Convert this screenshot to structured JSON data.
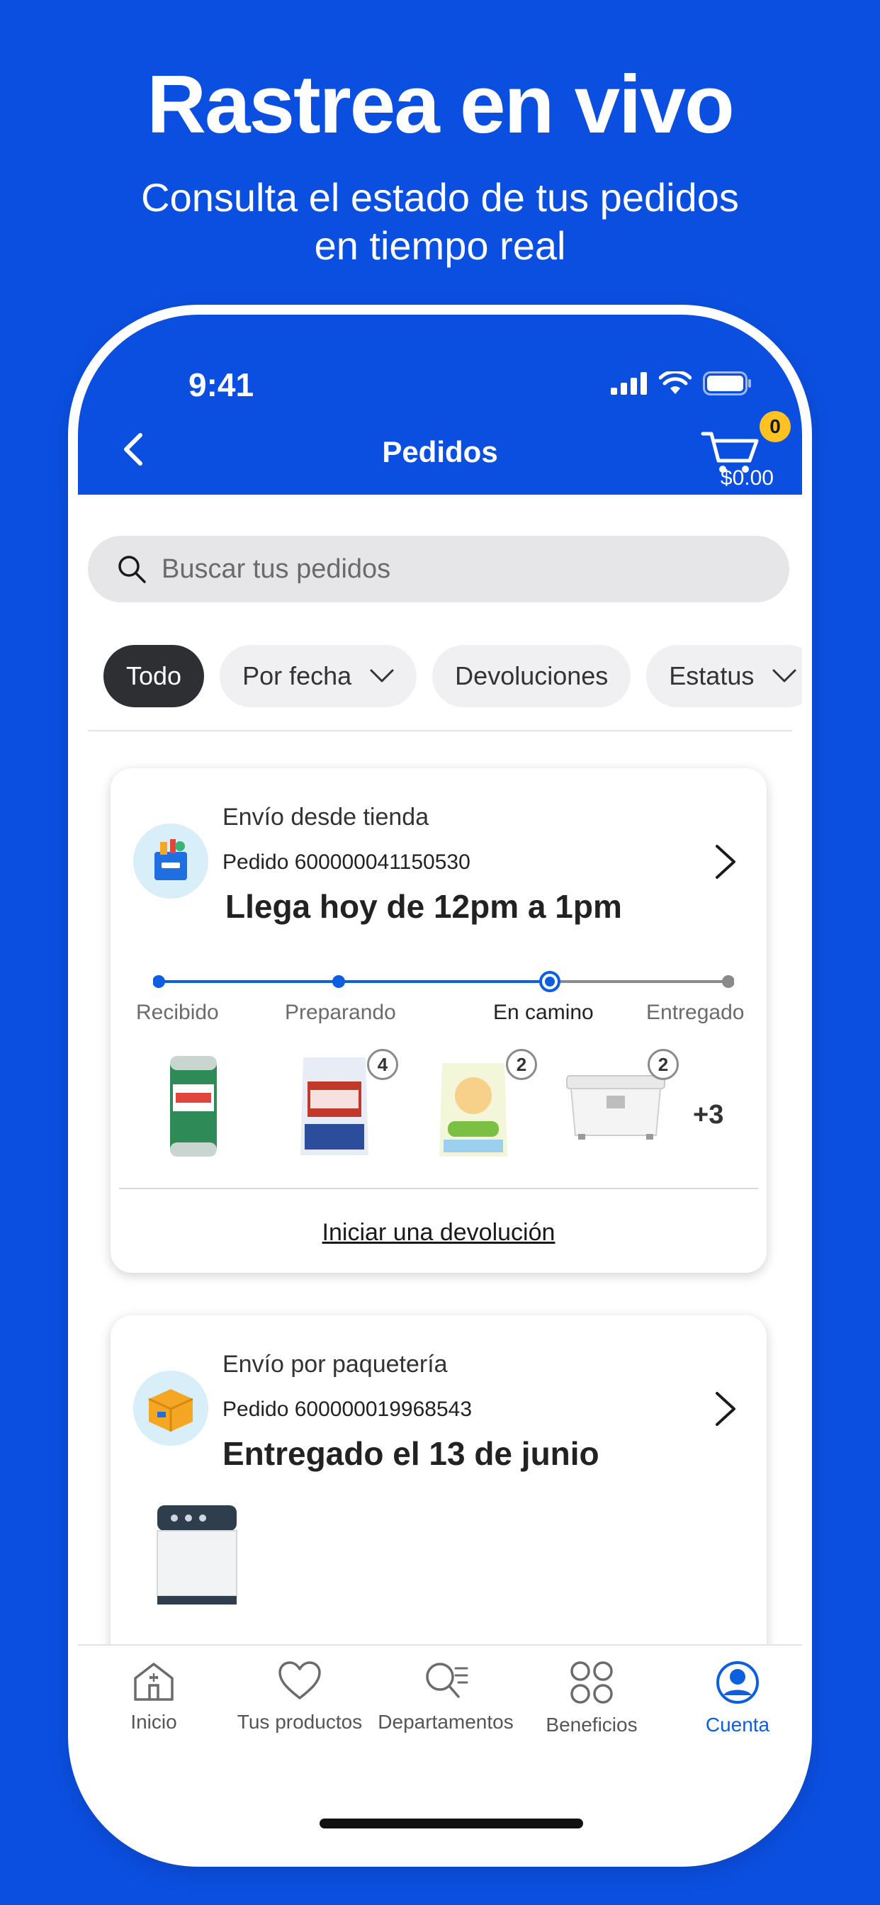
{
  "promo": {
    "headline": "Rastrea en vivo",
    "subline_1": "Consulta el estado de tus pedidos",
    "subline_2": "en tiempo real"
  },
  "status_bar": {
    "time": "9:41"
  },
  "app_bar": {
    "title": "Pedidos",
    "cart_count": "0",
    "cart_total": "$0.00"
  },
  "search": {
    "placeholder": "Buscar tus pedidos"
  },
  "filters": [
    {
      "label": "Todo",
      "active": true
    },
    {
      "label": "Por fecha",
      "dropdown": true
    },
    {
      "label": "Devoluciones"
    },
    {
      "label": "Estatus",
      "dropdown": true
    }
  ],
  "orders": [
    {
      "ship_type": "Envío desde tienda",
      "order_number": "Pedido 600000041150530",
      "eta": "Llega hoy de 12pm a 1pm",
      "steps": [
        "Recibido",
        "Preparando",
        "En camino",
        "Entregado"
      ],
      "current_step": 2,
      "items": [
        {
          "name": "wipes-canister"
        },
        {
          "name": "detergent-bag-roma",
          "qty": "4"
        },
        {
          "name": "detergent-bag-carisma",
          "qty": "2"
        },
        {
          "name": "storage-box",
          "qty": "2"
        }
      ],
      "more_items": "+3",
      "return_label": "Iniciar una devolución"
    },
    {
      "ship_type": "Envío por paquetería",
      "order_number": "Pedido 600000019968543",
      "eta": "Entregado el 13 de junio",
      "items": [
        {
          "name": "washing-machine"
        }
      ]
    }
  ],
  "tabs": [
    {
      "label": "Inicio",
      "icon": "home-icon"
    },
    {
      "label": "Tus productos",
      "icon": "heart-icon"
    },
    {
      "label": "Departamentos",
      "icon": "departments-icon"
    },
    {
      "label": "Beneficios",
      "icon": "benefits-icon"
    },
    {
      "label": "Cuenta",
      "icon": "account-icon",
      "active": true
    }
  ],
  "colors": {
    "brand_blue": "#0b4fe0",
    "progress_blue": "#0b5fe0",
    "badge_yellow": "#ffc220",
    "inactive_gray": "#8a8a8a"
  }
}
